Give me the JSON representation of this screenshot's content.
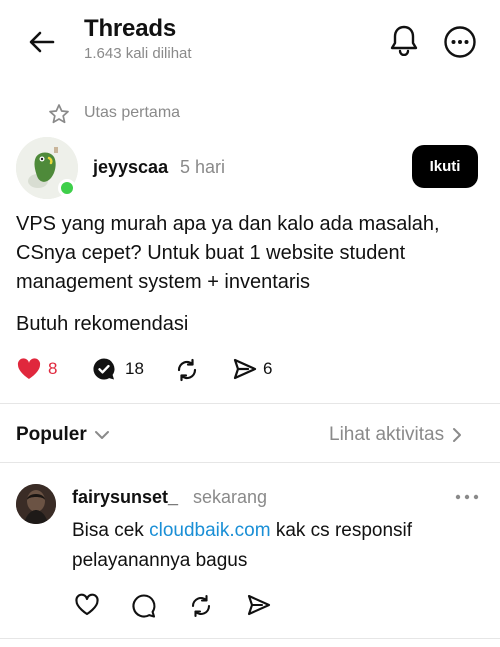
{
  "header": {
    "title": "Threads",
    "views": "1.643 kali dilihat"
  },
  "thread": {
    "label": "Utas pertama"
  },
  "post": {
    "author": "jeyyscaa",
    "time": "5 hari",
    "follow_label": "Ikuti",
    "text": "VPS yang murah apa ya dan kalo ada masalah, CSnya cepet? Untuk buat 1 website student management system + inventaris",
    "text2": "Butuh rekomendasi",
    "likes": "8",
    "replies": "18",
    "shares": "6"
  },
  "sort": {
    "label": "Populer",
    "activity_label": "Lihat aktivitas"
  },
  "reply": {
    "author": "fairysunset_",
    "time": "sekarang",
    "text_before": "Bisa cek ",
    "link": "cloudbaik.com",
    "text_after": " kak cs responsif pelayanannya bagus"
  },
  "colors": {
    "like_red": "#e0283d",
    "link_blue": "#1a8fd6",
    "online_green": "#3ecf4a"
  },
  "icons": [
    "back-arrow-icon",
    "bell-icon",
    "more-options-icon",
    "star-icon",
    "heart-icon",
    "reply-icon",
    "repost-icon",
    "share-icon",
    "chevron-down-icon",
    "chevron-right-icon",
    "ellipsis-icon"
  ]
}
